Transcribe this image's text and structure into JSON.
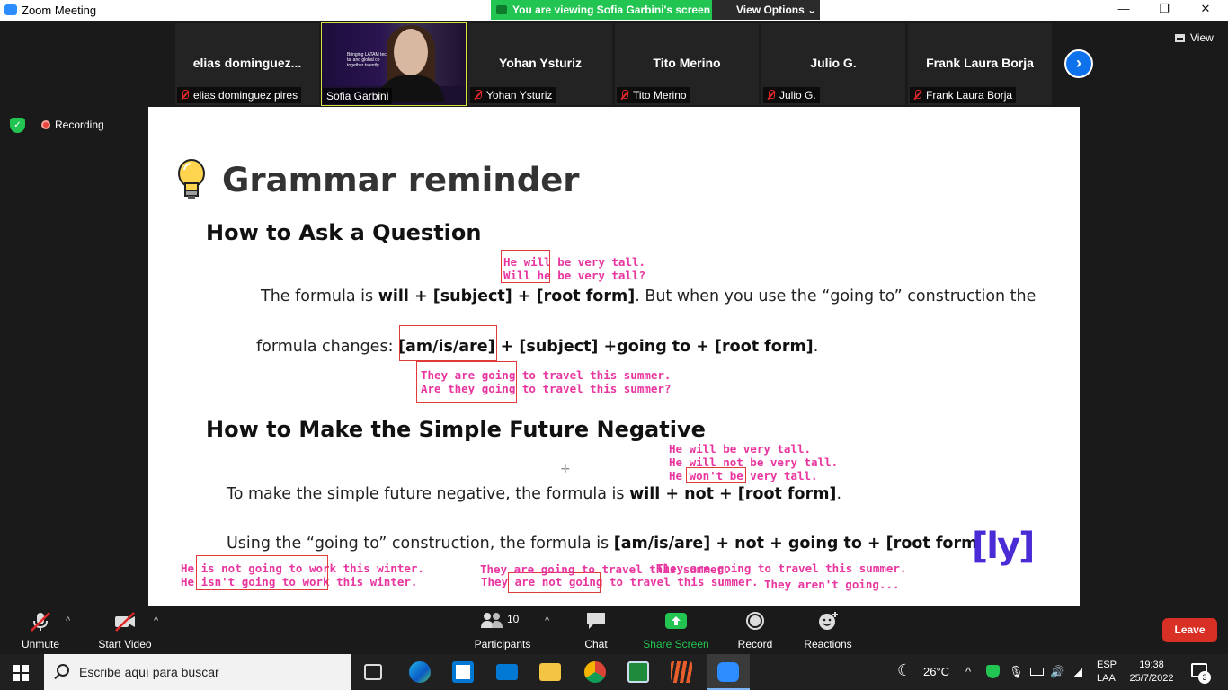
{
  "window": {
    "title": "Zoom Meeting",
    "minimize": "—",
    "restore": "❐",
    "close": "✕"
  },
  "banner": {
    "viewing": "You are viewing Sofia Garbini's screen",
    "view_options": "View Options ⌄"
  },
  "participants": [
    {
      "big": "elias  dominguez...",
      "plate": "elias dominguez pires",
      "muted": true
    },
    {
      "big": "",
      "plate": "Sofia Garbini",
      "muted": false
    },
    {
      "big": "Yohan Ysturiz",
      "plate": "Yohan Ysturiz",
      "muted": true
    },
    {
      "big": "Tito Merino",
      "plate": "Tito Merino",
      "muted": true
    },
    {
      "big": "Julio G.",
      "plate": "Julio G.",
      "muted": true
    },
    {
      "big": "Frank Laura Borja",
      "plate": "Frank Laura Borja",
      "muted": true
    }
  ],
  "sofia_video_text": "Bringing LATAM tech tal and global co together talently",
  "view_button": "View",
  "next_page": "›",
  "recording": "Recording",
  "slide": {
    "title": "Grammar reminder",
    "h2_question": "How to Ask a Question",
    "formula_1_pre": "The formula is ",
    "formula_1_bold": "will + [subject] + [root form]",
    "formula_1_post": ". But when you use the “going to” construction the",
    "formula_2_pre": "formula changes: ",
    "formula_2_bold": "[am/is/are] + [subject] +going to + [root form]",
    "formula_2_post": ".",
    "h2_negative": "How to Make the Simple Future Negative",
    "neg_1_pre": "To make the simple future negative, the formula is ",
    "neg_1_bold": "will + not + [root form]",
    "neg_1_post": ".",
    "neg_2_pre": "Using the “going to” construction, the formula is ",
    "neg_2_bold": "[am/is/are] + not + going to + [root form",
    "logo": "[ly]"
  },
  "annotations": {
    "a1": "He will be very tall.",
    "a2": "Will he be very tall?",
    "a3": "They are going to travel this summer.",
    "a4": "Are they going to travel this summer?",
    "a5": "He will be very tall.",
    "a6": "He will not be very tall.",
    "a7": "He won't be very tall.",
    "a8": "He is not going to work this winter.",
    "a9": "He isn't going to work this winter.",
    "a10": "They are going to travel this summer.",
    "a11": "They are not going to travel this summer.",
    "a12": "They aren't going..."
  },
  "toolbar": {
    "unmute": "Unmute",
    "start_video": "Start Video",
    "participants": "Participants",
    "participants_count": "10",
    "chat": "Chat",
    "share_screen": "Share Screen",
    "record": "Record",
    "reactions": "Reactions",
    "leave": "Leave"
  },
  "taskbar": {
    "search_placeholder": "Escribe aquí para buscar",
    "weather": "26°C",
    "lang_1": "ESP",
    "lang_2": "LAA",
    "time": "19:38",
    "date": "25/7/2022",
    "notifications": "3"
  },
  "colors": {
    "zoom_blue": "#0e72ed",
    "share_green": "#23c552",
    "leave_red": "#d93025",
    "annotation_pink": "#e8359f"
  }
}
